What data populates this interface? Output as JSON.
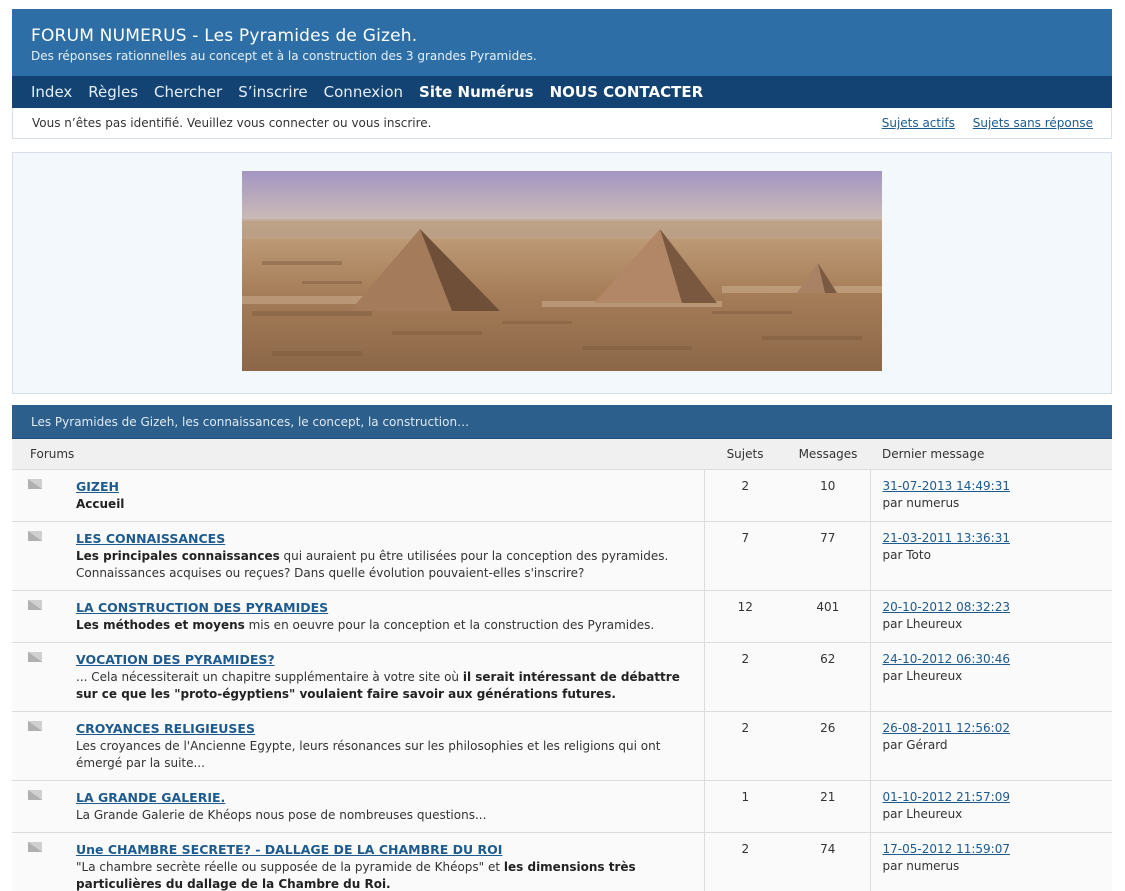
{
  "header": {
    "title": "FORUM NUMERUS - Les Pyramides de Gizeh.",
    "subtitle": "Des réponses rationnelles au concept et à la construction des 3 grandes Pyramides."
  },
  "nav": [
    "Index",
    "Règles",
    "Chercher",
    "S’inscrire",
    "Connexion",
    "Site Numérus",
    "NOUS CONTACTER"
  ],
  "status": {
    "message": "Vous n’êtes pas identifié. Veuillez vous connecter ou vous inscrire.",
    "links": [
      "Sujets actifs",
      "Sujets sans réponse"
    ]
  },
  "category": {
    "title": "Les Pyramides de Gizeh, les connaissances, le concept, la construction…"
  },
  "columns": {
    "forums": "Forums",
    "topics": "Sujets",
    "posts": "Messages",
    "last": "Dernier message"
  },
  "forums": [
    {
      "name": "GIZEH",
      "desc_bold": "Accueil",
      "desc": "",
      "topics": "2",
      "posts": "10",
      "last_date": "31-07-2013 14:49:31",
      "last_by": "par numerus"
    },
    {
      "name": "LES CONNAISSANCES",
      "desc_bold": "Les principales connaissances",
      "desc": " qui auraient pu être utilisées pour la conception des pyramides. Connaissances acquises ou reçues? Dans quelle évolution pouvaient-elles s'inscrire?",
      "topics": "7",
      "posts": "77",
      "last_date": "21-03-2011 13:36:31",
      "last_by": "par Toto"
    },
    {
      "name": "LA CONSTRUCTION DES PYRAMIDES",
      "desc_bold": "Les méthodes et moyens",
      "desc": " mis en oeuvre pour la conception et la construction des Pyramides.",
      "topics": "12",
      "posts": "401",
      "last_date": "20-10-2012 08:32:23",
      "last_by": "par Lheureux"
    },
    {
      "name": "VOCATION DES PYRAMIDES?",
      "desc_pre": "... Cela nécessiterait un chapitre supplémentaire à votre site où ",
      "desc_bold": "il serait intéressant de débattre sur ce que les \"proto-égyptiens\" voulaient faire savoir aux générations futures.",
      "topics": "2",
      "posts": "62",
      "last_date": "24-10-2012 06:30:46",
      "last_by": "par Lheureux"
    },
    {
      "name": "CROYANCES RELIGIEUSES",
      "desc_bold": "",
      "desc": "Les croyances de l'Ancienne Egypte, leurs résonances sur les philosophies et les religions qui ont émergé par la suite...",
      "topics": "2",
      "posts": "26",
      "last_date": "26-08-2011 12:56:02",
      "last_by": "par Gérard"
    },
    {
      "name": "LA GRANDE GALERIE.",
      "desc_bold": "",
      "desc": "La Grande Galerie de Khéops nous pose de nombreuses questions...",
      "topics": "1",
      "posts": "21",
      "last_date": "01-10-2012 21:57:09",
      "last_by": "par Lheureux"
    },
    {
      "name": "Une CHAMBRE SECRETE? - DALLAGE DE LA CHAMBRE DU ROI",
      "desc_pre": "\"La chambre secrète réelle ou supposée de la pyramide de Khéops\" et ",
      "desc_bold": "les dimensions très particulières du dallage de la Chambre du Roi.",
      "topics": "2",
      "posts": "74",
      "last_date": "17-05-2012 11:59:07",
      "last_by": "par numerus"
    }
  ]
}
